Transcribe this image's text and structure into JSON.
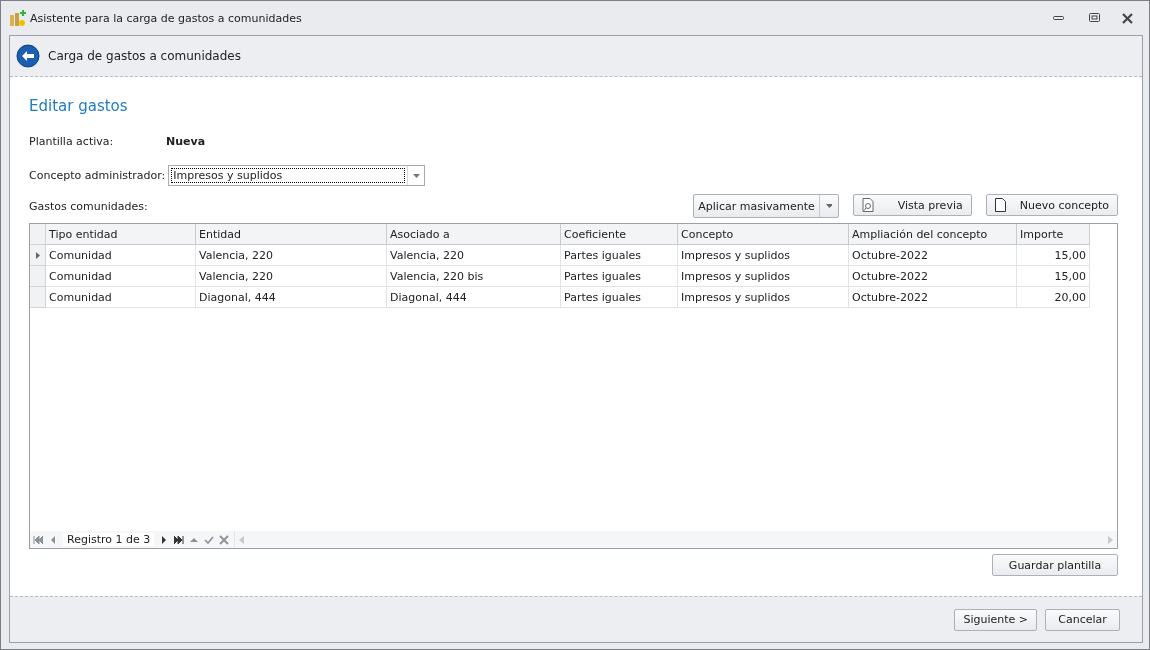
{
  "window": {
    "title": "Asistente para la carga de gastos a comunidades"
  },
  "header": {
    "title": "Carga de gastos a comunidades"
  },
  "section_title": "Editar gastos",
  "active_template": {
    "label": "Plantilla activa:",
    "value": "Nueva"
  },
  "admin_concept": {
    "label": "Concepto administrador:",
    "value": "Impresos y suplidos"
  },
  "grid_label": "Gastos comunidades:",
  "toolbar": [
    {
      "kind": "split",
      "label": "Aplicar masivamente"
    },
    {
      "kind": "preview",
      "label": "Vista previa"
    },
    {
      "kind": "new",
      "label": "Nuevo concepto"
    }
  ],
  "table": {
    "columns": [
      "Tipo entidad",
      "Entidad",
      "Asociado a",
      "Coeficiente",
      "Concepto",
      "Ampliación del concepto",
      "Importe"
    ],
    "rows": [
      {
        "selected": true,
        "cells": [
          "Comunidad",
          "Valencia, 220",
          "Valencia, 220",
          "Partes iguales",
          "Impresos y suplidos",
          "Octubre-2022",
          "15,00"
        ]
      },
      {
        "selected": false,
        "cells": [
          "Comunidad",
          "Valencia, 220",
          "Valencia, 220 bis",
          "Partes iguales",
          "Impresos y suplidos",
          "Octubre-2022",
          "15,00"
        ]
      },
      {
        "selected": false,
        "cells": [
          "Comunidad",
          "Diagonal, 444",
          "Diagonal, 444",
          "Partes iguales",
          "Impresos y suplidos",
          "Octubre-2022",
          "20,00"
        ]
      }
    ],
    "navigator": "Registro 1 de 3"
  },
  "save_button": "Guardar plantilla",
  "footer_buttons": [
    "Siguiente >",
    "Cancelar"
  ]
}
